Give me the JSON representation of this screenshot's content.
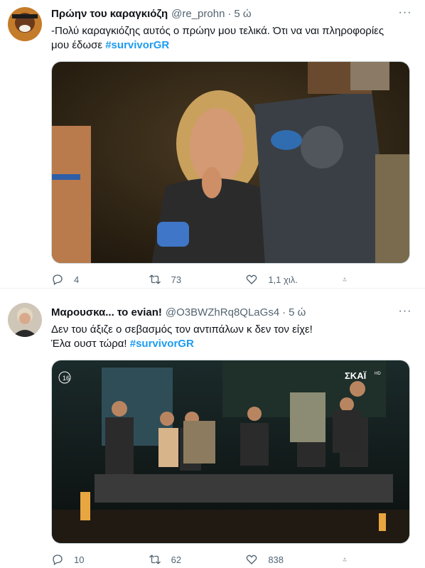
{
  "tweets": [
    {
      "name": "Πρώην του καραγκιόζη",
      "handle": "@re_prohn",
      "time": "5 ώ",
      "text_lines": [
        "-Πολύ καραγκιόζης αυτός ο πρώην μου τελικά. Ότι να ναι πληροφορίες",
        "μου έδωσε "
      ],
      "hashtag": "#survivorGR",
      "replies": "4",
      "retweets": "73",
      "likes": "1,1 χιλ."
    },
    {
      "name": "Μαρουσκα... το evian!",
      "handle": "@O3BWZhRq8QLaGs4",
      "time": "5 ώ",
      "text_lines": [
        "Δεν του άξιζε ο σεβασμός τον αντιπάλων κ δεν τον είχε!",
        "Έλα ουστ τώρα! "
      ],
      "hashtag": "#survivorGR",
      "replies": "10",
      "retweets": "62",
      "likes": "838",
      "video_overlay": {
        "badge": "16",
        "channel": "ΣΚΑΪ",
        "channel_hd": "HD"
      }
    }
  ],
  "colors": {
    "accent": "#1d9bf0",
    "muted": "#536471",
    "text": "#0f1419",
    "divider": "#eff3f4"
  },
  "icons": [
    "reply-icon",
    "retweet-icon",
    "like-icon",
    "share-icon",
    "more-icon"
  ]
}
